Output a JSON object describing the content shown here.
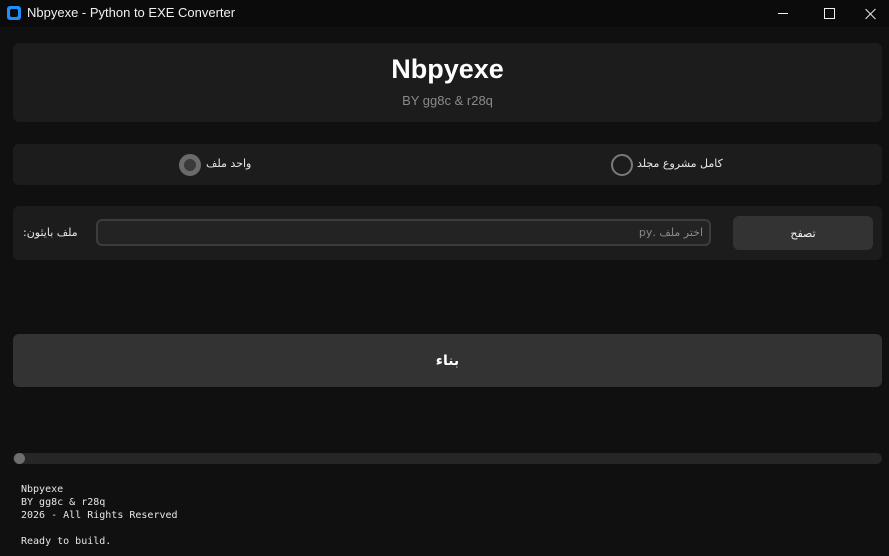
{
  "window": {
    "title": "Nbpyexe - Python to EXE Converter",
    "icon": "app-icon"
  },
  "header": {
    "title": "Nbpyexe",
    "subtitle": "BY gg8c & r28q"
  },
  "mode": {
    "options": [
      {
        "label": "واحد ملف",
        "selected": true
      },
      {
        "label": "كامل مشروع مجلد",
        "selected": false
      }
    ]
  },
  "file": {
    "label": ":ملف بايثون",
    "placeholder": "اختر ملف .py",
    "value": "",
    "browse_label": "تصفح"
  },
  "build": {
    "label": "بناء"
  },
  "progress": {
    "value": 0
  },
  "footer": {
    "lines": [
      "Nbpyexe",
      "BY gg8c & r28q",
      "2026 - All Rights Reserved"
    ],
    "status": "Ready to build."
  },
  "colors": {
    "background": "#101010",
    "panel": "#1c1c1c",
    "button": "#333333",
    "accent_icon": "#1f8fff"
  }
}
